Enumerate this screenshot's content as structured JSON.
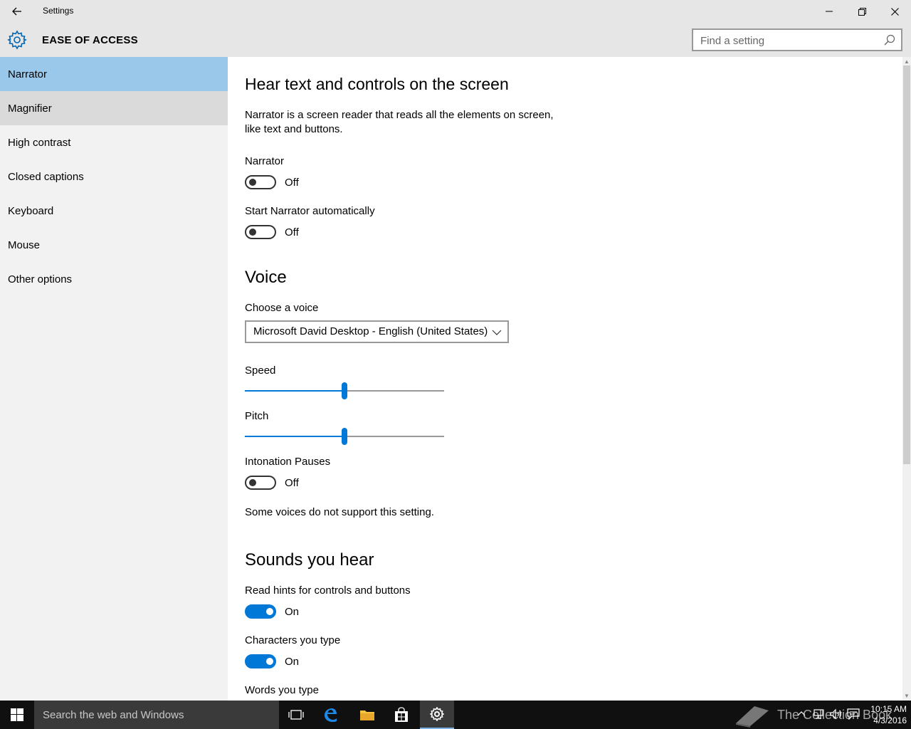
{
  "window": {
    "title": "Settings",
    "back_icon": "back-arrow-icon"
  },
  "header": {
    "section_title": "EASE OF ACCESS",
    "search_placeholder": "Find a setting"
  },
  "sidebar": {
    "items": [
      {
        "label": "Narrator",
        "state": "selected"
      },
      {
        "label": "Magnifier",
        "state": "hover"
      },
      {
        "label": "High contrast"
      },
      {
        "label": "Closed captions"
      },
      {
        "label": "Keyboard"
      },
      {
        "label": "Mouse"
      },
      {
        "label": "Other options"
      }
    ]
  },
  "main": {
    "heading": "Hear text and controls on the screen",
    "description_line1": "Narrator is a screen reader that reads all the elements on screen,",
    "description_line2": "like text and buttons.",
    "narrator": {
      "label": "Narrator",
      "state": "Off"
    },
    "start_auto": {
      "label": "Start Narrator automatically",
      "state": "Off"
    },
    "voice_heading": "Voice",
    "choose_voice": {
      "label": "Choose a voice",
      "value": "Microsoft David Desktop - English (United States)"
    },
    "speed": {
      "label": "Speed",
      "value_fraction": 0.5
    },
    "pitch": {
      "label": "Pitch",
      "value_fraction": 0.5
    },
    "intonation": {
      "label": "Intonation Pauses",
      "state": "Off"
    },
    "voice_note": "Some voices do not support this setting.",
    "sounds_heading": "Sounds you hear",
    "read_hints": {
      "label": "Read hints for controls and buttons",
      "state": "On"
    },
    "chars_typed": {
      "label": "Characters you type",
      "state": "On"
    },
    "words_typed": {
      "label": "Words you type"
    }
  },
  "taskbar": {
    "search_placeholder": "Search the web and Windows",
    "watermark": "The Collection Book",
    "time": "10:15 AM",
    "date": "4/3/2016"
  },
  "colors": {
    "accent": "#0078d7",
    "selected_nav": "#99c8eb",
    "chrome": "#e6e6e6",
    "sidebar": "#f2f2f2"
  }
}
